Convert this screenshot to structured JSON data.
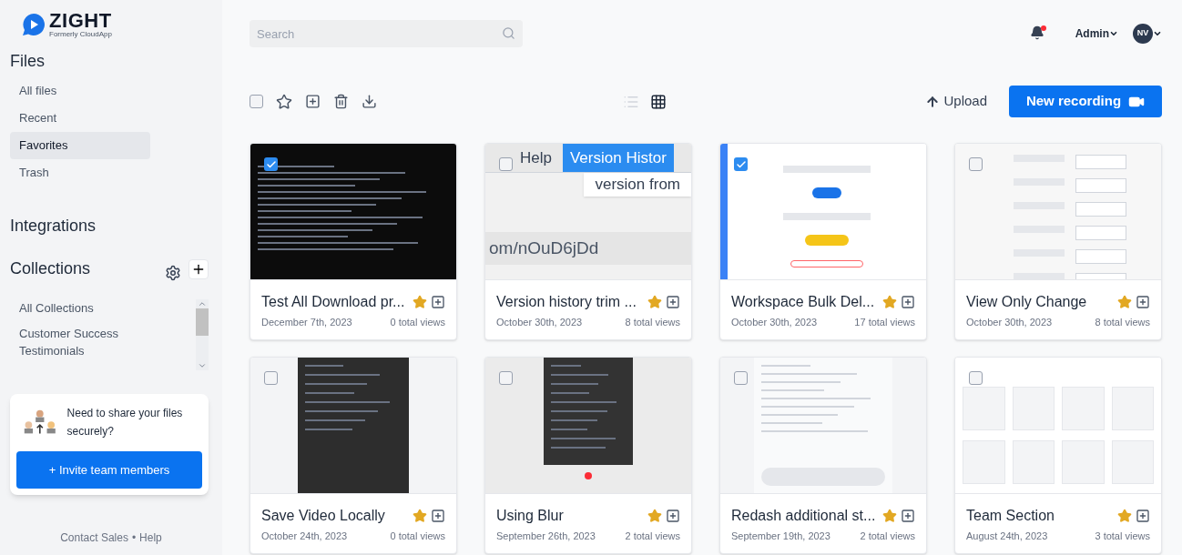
{
  "brand": {
    "name": "ZIGHT",
    "tagline": "Formerly CloudApp"
  },
  "sidebar": {
    "files_heading": "Files",
    "items": [
      {
        "label": "All files",
        "selected": false
      },
      {
        "label": "Recent",
        "selected": false
      },
      {
        "label": "Favorites",
        "selected": true
      },
      {
        "label": "Trash",
        "selected": false
      }
    ],
    "integrations_heading": "Integrations",
    "collections_heading": "Collections",
    "collections": [
      "All Collections",
      "Customer Success Testimonials"
    ],
    "promo": {
      "text": "Need to share your files securely?",
      "button": "+ Invite team members"
    },
    "footer": {
      "contact": "Contact Sales",
      "separator": "•",
      "help": "Help"
    }
  },
  "header": {
    "search": {
      "placeholder": "Search"
    },
    "user": "Admin",
    "avatar": "NV",
    "notification": true
  },
  "toolbar": {
    "select_all": {
      "checked": false
    },
    "list_view": {
      "selected": false
    },
    "grid_view": {
      "selected": true
    },
    "upload": "Upload",
    "new_recording": "New recording"
  },
  "files": [
    {
      "title": "Test All Download pr...",
      "date": "December 7th, 2023",
      "views": "0 total views",
      "selected": true,
      "starred": true,
      "thumbnail": {
        "kind": "terminal"
      }
    },
    {
      "title": "Version history trim ...",
      "date": "October 30th, 2023",
      "views": "8 total views",
      "selected": false,
      "starred": true,
      "thumbnail": {
        "kind": "browser",
        "texts": [
          "Help",
          "Version Histor",
          "version from",
          "om/nOuD6jDd"
        ]
      }
    },
    {
      "title": "Workspace Bulk Del...",
      "date": "October 30th, 2023",
      "views": "17 total views",
      "selected": true,
      "starred": true,
      "thumbnail": {
        "kind": "form"
      }
    },
    {
      "title": "View Only Change",
      "date": "October 30th, 2023",
      "views": "8 total views",
      "selected": false,
      "starred": true,
      "thumbnail": {
        "kind": "table"
      }
    },
    {
      "title": "Save Video Locally",
      "date": "October 24th, 2023",
      "views": "0 total views",
      "selected": false,
      "starred": true,
      "thumbnail": {
        "kind": "settings"
      }
    },
    {
      "title": "Using Blur",
      "date": "September 26th, 2023",
      "views": "2 total views",
      "selected": false,
      "starred": true,
      "thumbnail": {
        "kind": "settings-light"
      }
    },
    {
      "title": "Redash additional st...",
      "date": "September 19th, 2023",
      "views": "2 total views",
      "selected": false,
      "starred": true,
      "thumbnail": {
        "kind": "chat"
      }
    },
    {
      "title": "Team Section",
      "date": "August 24th, 2023",
      "views": "3 total views",
      "selected": false,
      "starred": true,
      "thumbnail": {
        "kind": "grid"
      }
    }
  ]
}
